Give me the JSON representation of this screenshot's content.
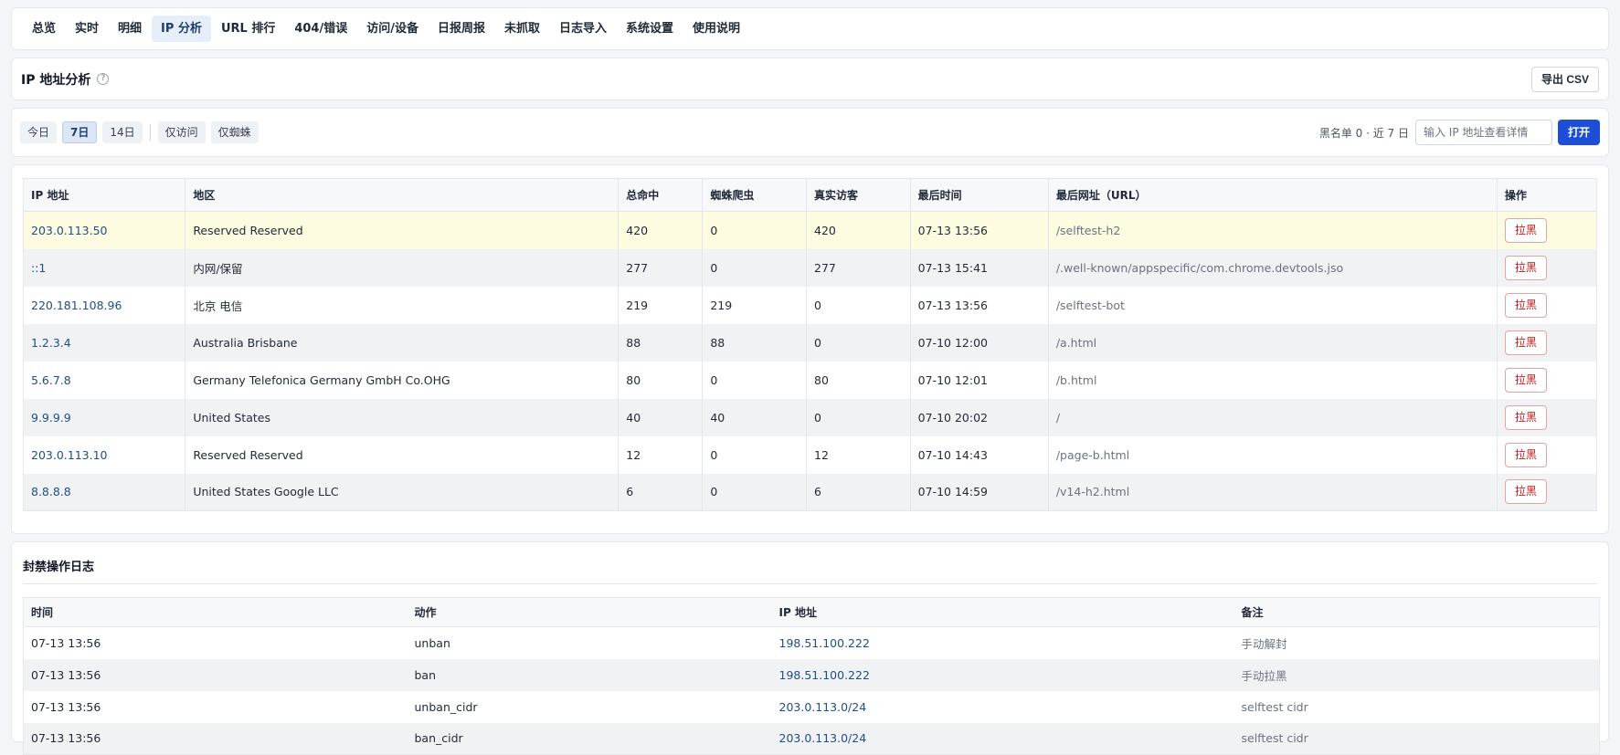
{
  "nav": {
    "items": [
      "总览",
      "实时",
      "明细",
      "IP 分析",
      "URL 排行",
      "404/错误",
      "访问/设备",
      "日报周报",
      "未抓取",
      "日志导入",
      "系统设置",
      "使用说明"
    ],
    "active": "IP 分析"
  },
  "header": {
    "title": "IP 地址分析",
    "help_icon": "?",
    "export_label": "导出 CSV"
  },
  "filters": {
    "ranges": [
      "今日",
      "7日",
      "14日"
    ],
    "active_range": "7日",
    "modes": [
      "仅访问",
      "仅蜘蛛"
    ],
    "blacklist_info": "黑名单 0 · 近 7 日",
    "ip_placeholder": "输入 IP 地址查看详情",
    "open_label": "打开"
  },
  "ip_table": {
    "headers": [
      "IP 地址",
      "地区",
      "总命中",
      "蜘蛛爬虫",
      "真实访客",
      "最后时间",
      "最后网址（URL）",
      "操作"
    ],
    "ban_label": "拉黑",
    "rows": [
      {
        "ip": "203.0.113.50",
        "region": "Reserved Reserved",
        "hits": "420",
        "spider": "0",
        "real": "420",
        "last_time": "07-13 13:56",
        "last_url": "/selftest-h2"
      },
      {
        "ip": "::1",
        "region": "内网/保留",
        "hits": "277",
        "spider": "0",
        "real": "277",
        "last_time": "07-13 15:41",
        "last_url": "/.well-known/appspecific/com.chrome.devtools.jso"
      },
      {
        "ip": "220.181.108.96",
        "region": "北京 电信",
        "hits": "219",
        "spider": "219",
        "real": "0",
        "last_time": "07-13 13:56",
        "last_url": "/selftest-bot"
      },
      {
        "ip": "1.2.3.4",
        "region": "Australia Brisbane",
        "hits": "88",
        "spider": "88",
        "real": "0",
        "last_time": "07-10 12:00",
        "last_url": "/a.html"
      },
      {
        "ip": "5.6.7.8",
        "region": "Germany Telefonica Germany GmbH Co.OHG",
        "hits": "80",
        "spider": "0",
        "real": "80",
        "last_time": "07-10 12:01",
        "last_url": "/b.html"
      },
      {
        "ip": "9.9.9.9",
        "region": "United States",
        "hits": "40",
        "spider": "40",
        "real": "0",
        "last_time": "07-10 20:02",
        "last_url": "/"
      },
      {
        "ip": "203.0.113.10",
        "region": "Reserved Reserved",
        "hits": "12",
        "spider": "0",
        "real": "12",
        "last_time": "07-10 14:43",
        "last_url": "/page-b.html"
      },
      {
        "ip": "8.8.8.8",
        "region": "United States Google LLC",
        "hits": "6",
        "spider": "0",
        "real": "6",
        "last_time": "07-10 14:59",
        "last_url": "/v14-h2.html"
      }
    ]
  },
  "ban_log": {
    "title": "封禁操作日志",
    "headers": [
      "时间",
      "动作",
      "IP 地址",
      "备注"
    ],
    "rows": [
      {
        "time": "07-13 13:56",
        "action": "unban",
        "ip": "198.51.100.222",
        "note": "手动解封"
      },
      {
        "time": "07-13 13:56",
        "action": "ban",
        "ip": "198.51.100.222",
        "note": "手动拉黑"
      },
      {
        "time": "07-13 13:56",
        "action": "unban_cidr",
        "ip": "203.0.113.0/24",
        "note": "selftest cidr"
      },
      {
        "time": "07-13 13:56",
        "action": "ban_cidr",
        "ip": "203.0.113.0/24",
        "note": "selftest cidr"
      }
    ]
  },
  "colors": {
    "accent": "#1d4ed8",
    "link": "#1e4e8c",
    "highlight_row": "#fdfce0",
    "ban_red": "#b91c1c"
  }
}
